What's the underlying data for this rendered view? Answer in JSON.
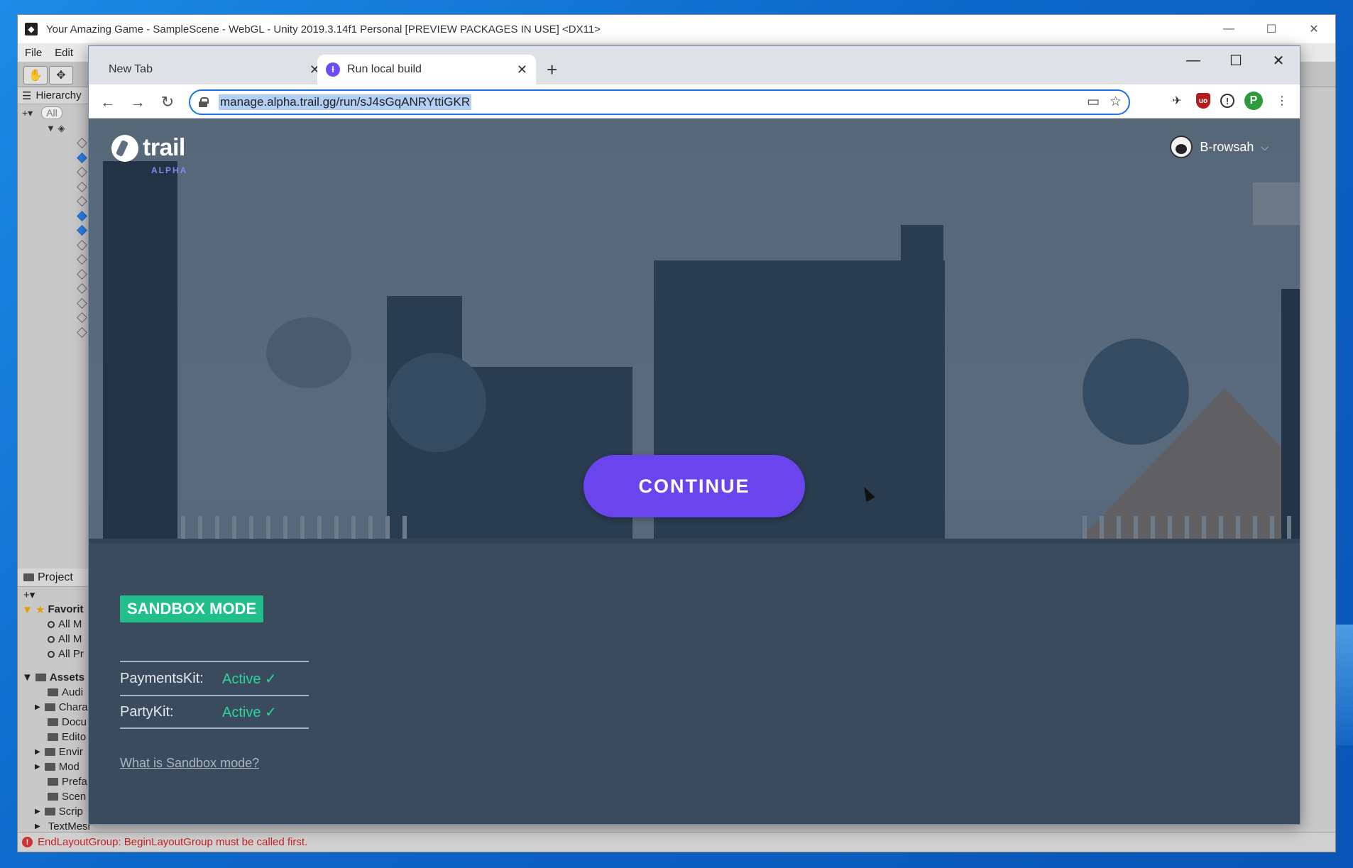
{
  "unity": {
    "title": "Your Amazing Game - SampleScene - WebGL - Unity 2019.3.14f1 Personal [PREVIEW PACKAGES IN USE] <DX11>",
    "menu": [
      "File",
      "Edit"
    ],
    "hierarchy_label": "Hierarchy",
    "search_placeholder": "All",
    "project_label": "Project",
    "project_rows": [
      "Favorit",
      "All M",
      "All M",
      "All Pr",
      "Assets",
      "Audi",
      "Chara",
      "Docu",
      "Edito",
      "Envir",
      "Mod",
      "Prefa",
      "Scen",
      "Scrip",
      "TextMesh Pro"
    ],
    "status_message": "EndLayoutGroup: BeginLayoutGroup must be called first."
  },
  "browser": {
    "tabs": [
      {
        "label": "New Tab",
        "active": false
      },
      {
        "label": "Run local build",
        "active": true
      }
    ],
    "url": "manage.alpha.trail.gg/run/sJ4sGqANRYttiGKR",
    "profile_initial": "P"
  },
  "trail": {
    "logo_text": "trail",
    "logo_sub": "ALPHA",
    "username": "B-rowsah",
    "continue_label": "CONTINUE",
    "sandbox_badge": "SANDBOX MODE",
    "kits": [
      {
        "name": "PaymentsKit:",
        "status": "Active ✓"
      },
      {
        "name": "PartyKit:",
        "status": "Active ✓"
      }
    ],
    "sandbox_link": "What is Sandbox mode?"
  }
}
